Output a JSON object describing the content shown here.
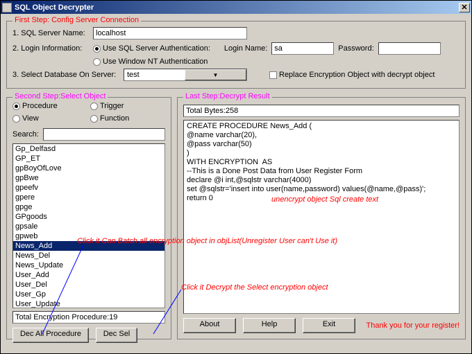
{
  "window": {
    "title": "SQL Object Decrypter"
  },
  "step1": {
    "legend": "First Step: Config Server Connection",
    "server_label": "1. SQL Server Name:",
    "server_value": "localhost",
    "login_label": "2. Login Information:",
    "use_sql_auth": "Use SQL Server Authentication:",
    "use_nt_auth": "Use Window NT Authentication",
    "login_name_label": "Login Name:",
    "login_name_value": "sa",
    "password_label": "Password:",
    "password_value": "",
    "select_db_label": "3. Select Database On Server:",
    "db_value": "test",
    "replace_label": "Replace Encryption Object with decrypt object"
  },
  "step2": {
    "legend": "Second Step:Select Object",
    "radios": {
      "procedure": "Procedure",
      "trigger": "Trigger",
      "view": "View",
      "function": "Function"
    },
    "search_label": "Search:",
    "search_value": "",
    "items": [
      "Gp_Delfasd",
      "GP_ET",
      "gpBoyOfLove",
      "gpBwe",
      "gpeefv",
      "gpere",
      "gpge",
      "GPgoods",
      "gpsale",
      "gpweb",
      "News_Add",
      "News_Del",
      "News_Update",
      "User_Add",
      "User_Del",
      "User_Gp",
      "User_Update"
    ],
    "selected_index": 10,
    "total": "Total Encryption Procedure:19",
    "dec_all": "Dec All Procedure",
    "dec_sel": "Dec Sel"
  },
  "step3": {
    "legend": "Last Step:Decrypt Result",
    "bytes": "Total Bytes:258",
    "sql": "CREATE PROCEDURE News_Add (\n@name varchar(20),\n@pass varchar(50)\n)\nWITH ENCRYPTION  AS\n--This is a Done Post Data from User Register Form\ndeclare @i int,@sqlstr varchar(4000)\nset @sqlstr='insert into user(name,password) values(@name,@pass)';\nreturn 0",
    "about": "About",
    "help": "Help",
    "exit": "Exit",
    "thanks": "Thank you for your register!"
  },
  "anno": {
    "unencrypt": "unencrypt object Sql create text",
    "batch": "Click it Can Batch all encryption object in objList(Unregister User can't Use it)",
    "decrypt": "Click it Decrypt the Select encryption object"
  }
}
